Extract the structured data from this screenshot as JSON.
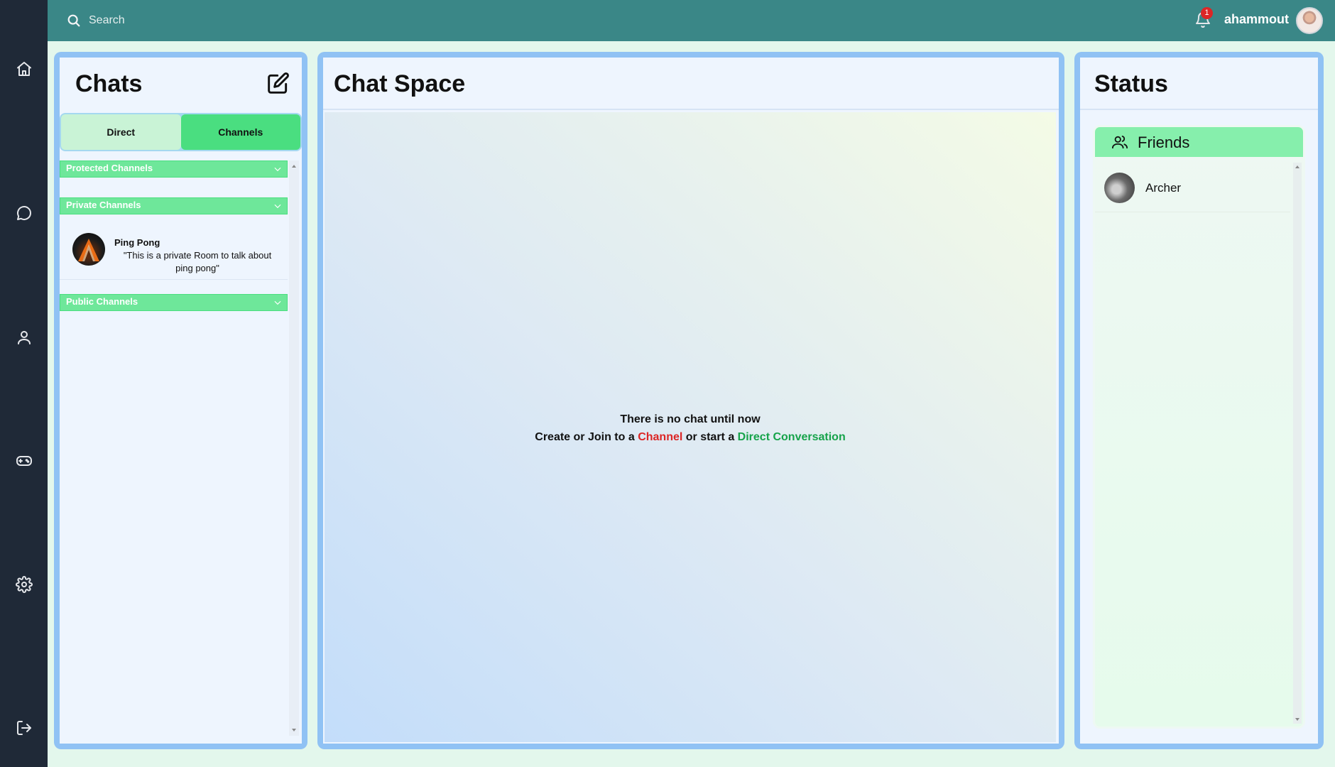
{
  "nav": {
    "items": [
      {
        "name": "home",
        "icon": "home-icon"
      },
      {
        "name": "chat",
        "icon": "chat-bubble-icon"
      },
      {
        "name": "profile",
        "icon": "user-icon"
      },
      {
        "name": "game",
        "icon": "gamepad-icon"
      },
      {
        "name": "settings",
        "icon": "gear-icon"
      },
      {
        "name": "logout",
        "icon": "logout-icon"
      }
    ]
  },
  "topbar": {
    "search_placeholder": "Search",
    "notification_count": "1",
    "username": "ahammout"
  },
  "chats": {
    "title": "Chats",
    "tabs": {
      "direct": "Direct",
      "channels": "Channels"
    },
    "active_tab": "Channels",
    "sections": {
      "protected": "Protected Channels",
      "private": "Private Channels",
      "public": "Public Channels"
    },
    "private_channels": [
      {
        "name": "Ping Pong",
        "description": "\"This is a private Room to talk about ping pong\""
      }
    ]
  },
  "chat_space": {
    "title": "Chat Space",
    "empty_line1": "There is no chat until now",
    "empty_prefix": "Create or Join to a ",
    "empty_channel": "Channel",
    "empty_middle": " or start a ",
    "empty_direct": "Direct Conversation"
  },
  "status": {
    "title": "Status",
    "friends_label": "Friends",
    "friends": [
      {
        "name": "Archer"
      }
    ]
  },
  "colors": {
    "rail": "#1f2937",
    "topbar": "#3a8787",
    "panel_border": "#90c2f4",
    "accent_green": "#4ade80",
    "link_red": "#dc2626",
    "link_green": "#16a34a"
  }
}
